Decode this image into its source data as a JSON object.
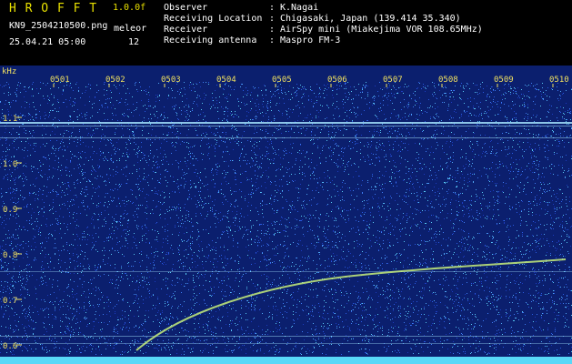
{
  "header": {
    "title": "H R O F F T",
    "version": "1.0.0f",
    "filename": "KN9_2504210500.png",
    "timestamp": "25.04.21 05:00",
    "mode_label": "meleor",
    "mode_value": "12",
    "info": [
      {
        "label": "Observer",
        "sep": ":",
        "value": "K.Nagai"
      },
      {
        "label": "Receiving Location",
        "sep": ":",
        "value": "Chigasaki, Japan (139.414 35.340)"
      },
      {
        "label": "Receiver",
        "sep": ":",
        "value": "AirSpy mini (Miakejima VOR 108.65MHz)"
      },
      {
        "label": "Receiving antenna",
        "sep": ":",
        "value": "Maspro FM-3"
      }
    ]
  },
  "plot": {
    "y_unit": "kHz",
    "y_ticks": [
      "1.1",
      "1.0",
      "0.9",
      "0.8",
      "0.7",
      "0.6"
    ],
    "x_ticks": [
      "0501",
      "0502",
      "0503",
      "0504",
      "0505",
      "0506",
      "0507",
      "0508",
      "0509",
      "0510"
    ],
    "colors": {
      "background": "#0b1f6e",
      "noise": [
        "#1d3cbf",
        "#2a5ae0",
        "#3d7bf0",
        "#4fa6f2",
        "#57c8f0"
      ],
      "tick_text": "#f0e060",
      "header_text": "#ffffff",
      "title_text": "#e8e000",
      "carrier": "#9ad6f4",
      "trail": "#c8f07a",
      "bottom_band": "#58d8f8"
    }
  }
}
